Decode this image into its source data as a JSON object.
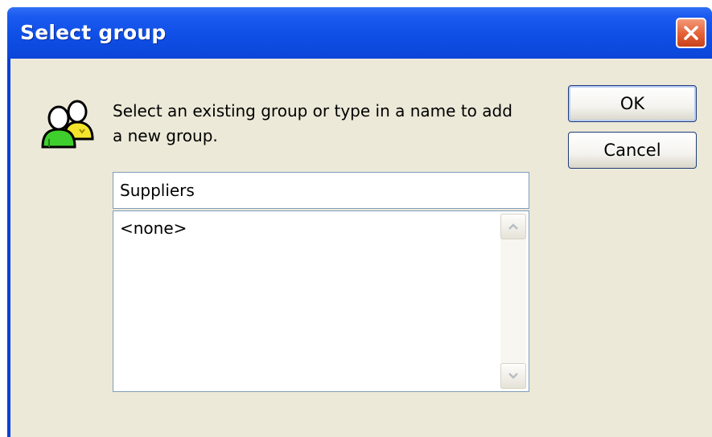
{
  "window": {
    "title": "Select group"
  },
  "dialog": {
    "message": "Select an existing group or type in a name to add a new group.",
    "message_line1": "Select an existing group or type in a name to add",
    "message_line2": "a new group.",
    "group_input_value": "Suppliers",
    "group_list": [
      "<none>"
    ],
    "ok_label": "OK",
    "cancel_label": "Cancel"
  },
  "icons": {
    "close": "close-icon",
    "groups": "user-group-icon",
    "scroll_up": "chevron-up-icon",
    "scroll_down": "chevron-down-icon"
  },
  "colors": {
    "titlebar": "#0f4fe6",
    "client_bg": "#ece9d8",
    "close_button": "#e35f36",
    "field_border": "#7f9db9"
  }
}
